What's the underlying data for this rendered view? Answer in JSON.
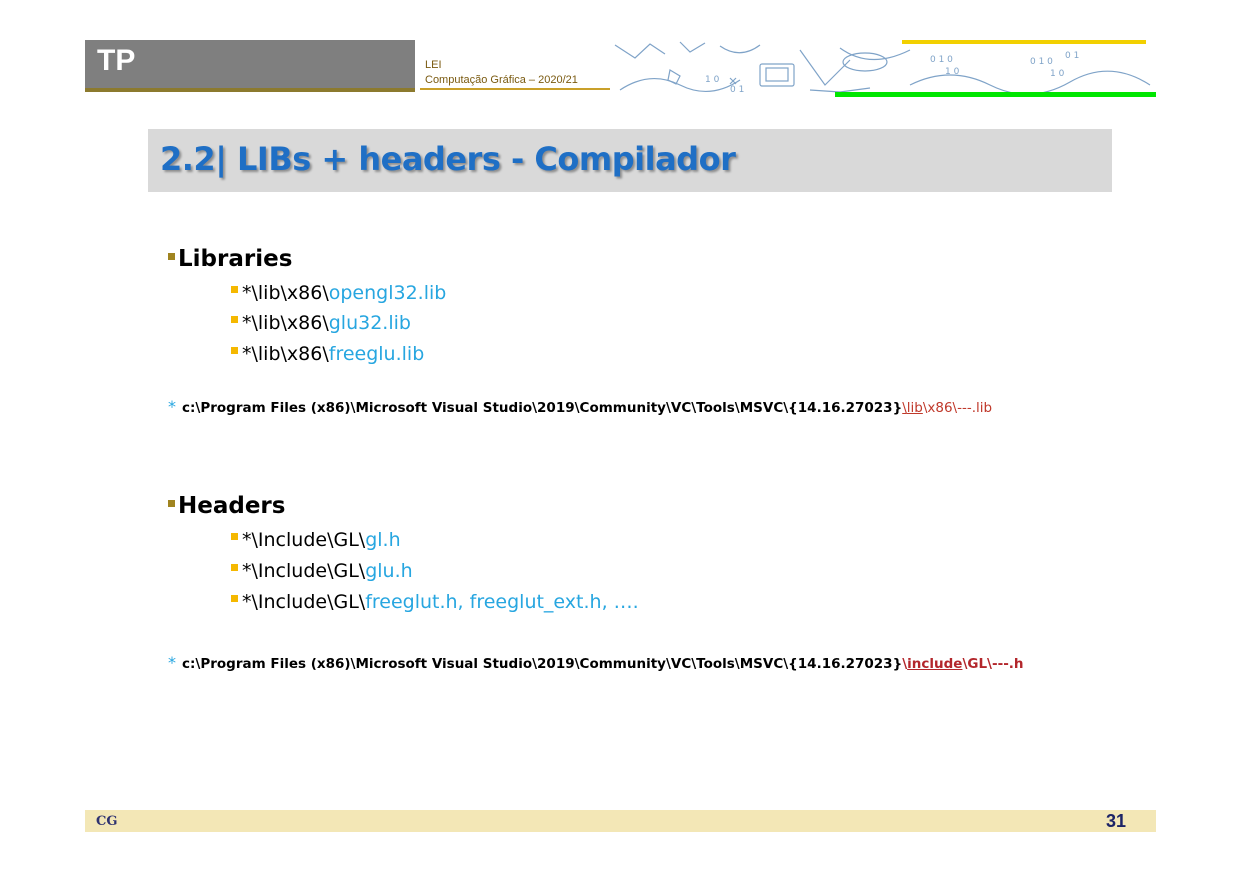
{
  "header": {
    "tp_label": "TP",
    "lei": "LEI",
    "course": "Computação Gráfica – 2020/21"
  },
  "title": "2.2| LIBs + headers  - Compilador",
  "libraries": {
    "heading": "Libraries",
    "items": [
      {
        "prefix": "*\\lib\\x86\\",
        "name": "opengl32.lib"
      },
      {
        "prefix": "*\\lib\\x86\\",
        "name": "glu32.lib"
      },
      {
        "prefix": "*\\lib\\x86\\",
        "name": "freeglu.lib"
      }
    ],
    "path": {
      "asterisk": "*",
      "base": "c:\\Program Files (x86)\\Microsoft Visual Studio\\2019\\Community\\VC\\Tools\\MSVC\\{14.16.27023}",
      "sep": "\\",
      "dir": "lib",
      "tail": "\\x86\\---.lib"
    }
  },
  "headers": {
    "heading": "Headers",
    "items": [
      {
        "prefix": "*\\Include\\GL\\",
        "name": "gl.h"
      },
      {
        "prefix": "*\\Include\\GL\\",
        "name": "glu.h"
      },
      {
        "prefix": "*\\Include\\GL\\",
        "name": "freeglut.h, freeglut_ext.h, …."
      }
    ],
    "path": {
      "asterisk": "*",
      "base": "c:\\Program Files (x86)\\Microsoft Visual Studio\\2019\\Community\\VC\\Tools\\MSVC\\{14.16.27023}",
      "sep": "\\",
      "dir": "include",
      "tail": "\\GL\\---.h"
    }
  },
  "footer": {
    "left": "CG",
    "page_number": "31"
  },
  "colors": {
    "title": "#1f6fc5",
    "accent_blue": "#27a6e0",
    "accent_red": "#c0392b",
    "footer_bar": "#f3e7b6"
  }
}
